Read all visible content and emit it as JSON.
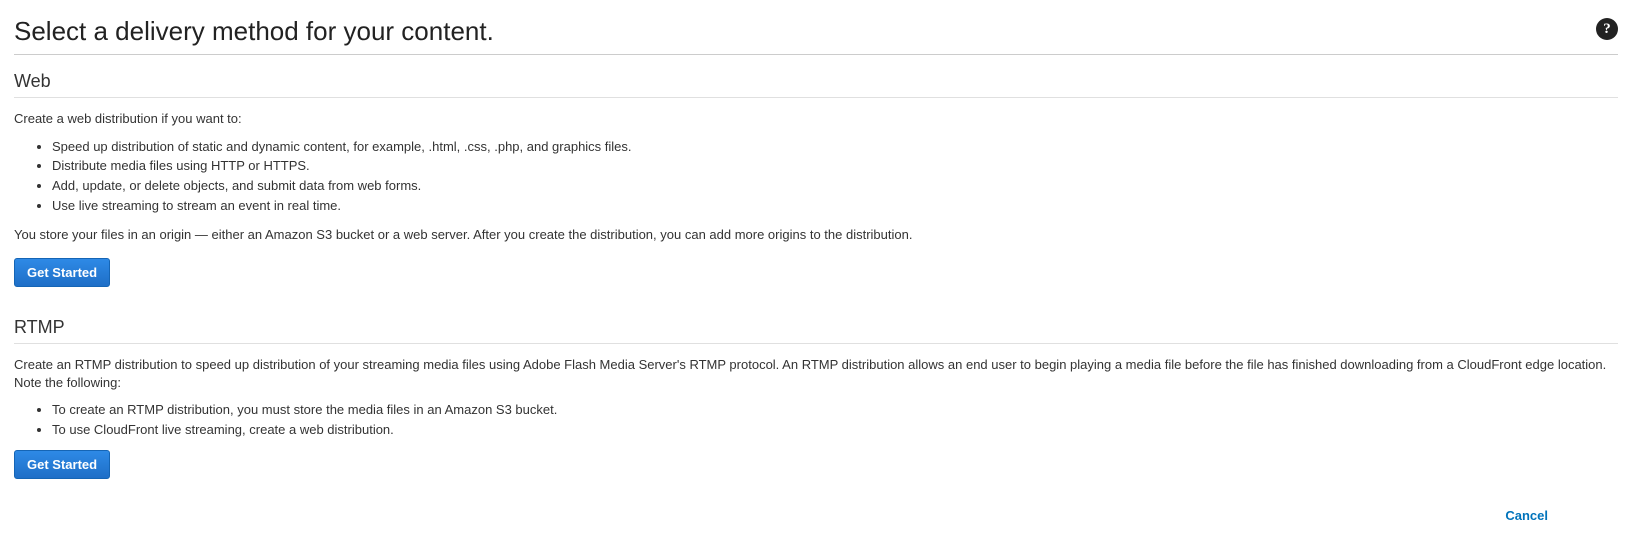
{
  "page_title": "Select a delivery method for your content.",
  "web": {
    "heading": "Web",
    "intro": "Create a web distribution if you want to:",
    "bullets": [
      "Speed up distribution of static and dynamic content, for example, .html, .css, .php, and graphics files.",
      "Distribute media files using HTTP or HTTPS.",
      "Add, update, or delete objects, and submit data from web forms.",
      "Use live streaming to stream an event in real time."
    ],
    "note": "You store your files in an origin — either an Amazon S3 bucket or a web server. After you create the distribution, you can add more origins to the distribution.",
    "button_label": "Get Started"
  },
  "rtmp": {
    "heading": "RTMP",
    "intro": "Create an RTMP distribution to speed up distribution of your streaming media files using Adobe Flash Media Server's RTMP protocol. An RTMP distribution allows an end user to begin playing a media file before the file has finished downloading from a CloudFront edge location. Note the following:",
    "bullets": [
      "To create an RTMP distribution, you must store the media files in an Amazon S3 bucket.",
      "To use CloudFront live streaming, create a web distribution."
    ],
    "button_label": "Get Started"
  },
  "footer": {
    "cancel_label": "Cancel"
  }
}
